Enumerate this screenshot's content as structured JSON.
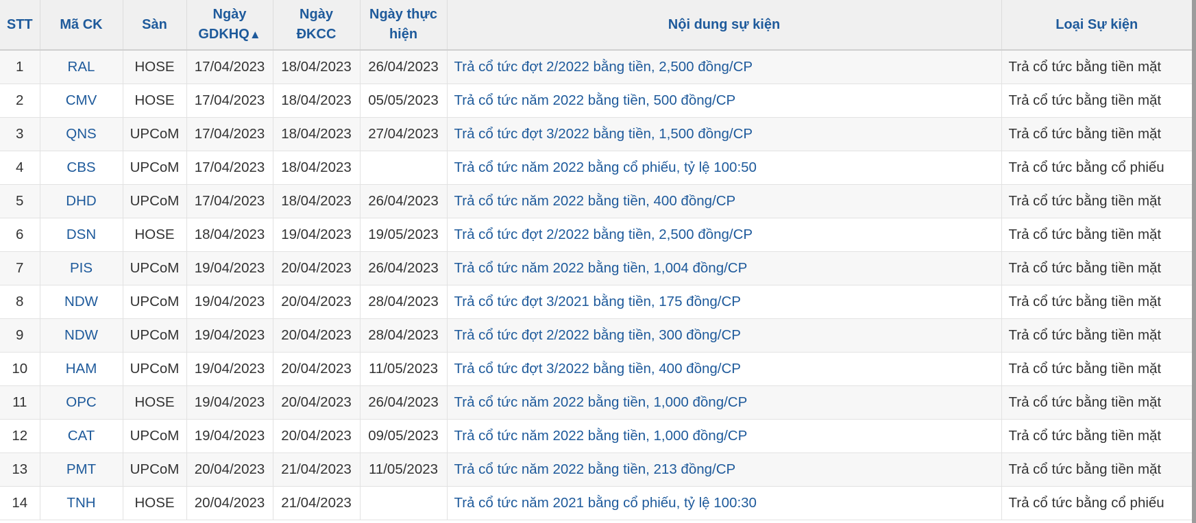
{
  "table": {
    "headers": {
      "stt": "STT",
      "ma_ck": "Mã CK",
      "san": "Sàn",
      "gdkhq_line1": "Ngày",
      "gdkhq_line2": "GDKHQ",
      "gdkhq_sort": "▲",
      "dkcc_line1": "Ngày",
      "dkcc_line2": "ĐKCC",
      "thuc_hien_line1": "Ngày thực",
      "thuc_hien_line2": "hiện",
      "noi_dung": "Nội dung sự kiện",
      "loai": "Loại Sự kiện"
    },
    "rows": [
      {
        "stt": "1",
        "ma": "RAL",
        "san": "HOSE",
        "gdkhq": "17/04/2023",
        "dkcc": "18/04/2023",
        "thuc_hien": "26/04/2023",
        "noi_dung": "Trả cổ tức đợt 2/2022 bằng tiền, 2,500 đồng/CP",
        "loai": "Trả cổ tức bằng tiền mặt"
      },
      {
        "stt": "2",
        "ma": "CMV",
        "san": "HOSE",
        "gdkhq": "17/04/2023",
        "dkcc": "18/04/2023",
        "thuc_hien": "05/05/2023",
        "noi_dung": "Trả cổ tức năm 2022 bằng tiền, 500 đồng/CP",
        "loai": "Trả cổ tức bằng tiền mặt"
      },
      {
        "stt": "3",
        "ma": "QNS",
        "san": "UPCoM",
        "gdkhq": "17/04/2023",
        "dkcc": "18/04/2023",
        "thuc_hien": "27/04/2023",
        "noi_dung": "Trả cổ tức đợt 3/2022 bằng tiền, 1,500 đồng/CP",
        "loai": "Trả cổ tức bằng tiền mặt"
      },
      {
        "stt": "4",
        "ma": "CBS",
        "san": "UPCoM",
        "gdkhq": "17/04/2023",
        "dkcc": "18/04/2023",
        "thuc_hien": "",
        "noi_dung": "Trả cổ tức năm 2022 bằng cổ phiếu, tỷ lệ 100:50",
        "loai": "Trả cổ tức bằng cổ phiếu"
      },
      {
        "stt": "5",
        "ma": "DHD",
        "san": "UPCoM",
        "gdkhq": "17/04/2023",
        "dkcc": "18/04/2023",
        "thuc_hien": "26/04/2023",
        "noi_dung": "Trả cổ tức năm 2022 bằng tiền, 400 đồng/CP",
        "loai": "Trả cổ tức bằng tiền mặt"
      },
      {
        "stt": "6",
        "ma": "DSN",
        "san": "HOSE",
        "gdkhq": "18/04/2023",
        "dkcc": "19/04/2023",
        "thuc_hien": "19/05/2023",
        "noi_dung": "Trả cổ tức đợt 2/2022 bằng tiền, 2,500 đồng/CP",
        "loai": "Trả cổ tức bằng tiền mặt"
      },
      {
        "stt": "7",
        "ma": "PIS",
        "san": "UPCoM",
        "gdkhq": "19/04/2023",
        "dkcc": "20/04/2023",
        "thuc_hien": "26/04/2023",
        "noi_dung": "Trả cổ tức năm 2022 bằng tiền, 1,004 đồng/CP",
        "loai": "Trả cổ tức bằng tiền mặt"
      },
      {
        "stt": "8",
        "ma": "NDW",
        "san": "UPCoM",
        "gdkhq": "19/04/2023",
        "dkcc": "20/04/2023",
        "thuc_hien": "28/04/2023",
        "noi_dung": "Trả cổ tức đợt 3/2021 bằng tiền, 175 đồng/CP",
        "loai": "Trả cổ tức bằng tiền mặt"
      },
      {
        "stt": "9",
        "ma": "NDW",
        "san": "UPCoM",
        "gdkhq": "19/04/2023",
        "dkcc": "20/04/2023",
        "thuc_hien": "28/04/2023",
        "noi_dung": "Trả cổ tức đợt 2/2022 bằng tiền, 300 đồng/CP",
        "loai": "Trả cổ tức bằng tiền mặt"
      },
      {
        "stt": "10",
        "ma": "HAM",
        "san": "UPCoM",
        "gdkhq": "19/04/2023",
        "dkcc": "20/04/2023",
        "thuc_hien": "11/05/2023",
        "noi_dung": "Trả cổ tức đợt 3/2022 bằng tiền, 400 đồng/CP",
        "loai": "Trả cổ tức bằng tiền mặt"
      },
      {
        "stt": "11",
        "ma": "OPC",
        "san": "HOSE",
        "gdkhq": "19/04/2023",
        "dkcc": "20/04/2023",
        "thuc_hien": "26/04/2023",
        "noi_dung": "Trả cổ tức năm 2022 bằng tiền, 1,000 đồng/CP",
        "loai": "Trả cổ tức bằng tiền mặt"
      },
      {
        "stt": "12",
        "ma": "CAT",
        "san": "UPCoM",
        "gdkhq": "19/04/2023",
        "dkcc": "20/04/2023",
        "thuc_hien": "09/05/2023",
        "noi_dung": "Trả cổ tức năm 2022 bằng tiền, 1,000 đồng/CP",
        "loai": "Trả cổ tức bằng tiền mặt"
      },
      {
        "stt": "13",
        "ma": "PMT",
        "san": "UPCoM",
        "gdkhq": "20/04/2023",
        "dkcc": "21/04/2023",
        "thuc_hien": "11/05/2023",
        "noi_dung": "Trả cổ tức năm 2022 bằng tiền, 213 đồng/CP",
        "loai": "Trả cổ tức bằng tiền mặt"
      },
      {
        "stt": "14",
        "ma": "TNH",
        "san": "HOSE",
        "gdkhq": "20/04/2023",
        "dkcc": "21/04/2023",
        "thuc_hien": "",
        "noi_dung": "Trả cổ tức năm 2021 bằng cổ phiếu, tỷ lệ 100:30",
        "loai": "Trả cổ tức bằng cổ phiếu"
      }
    ]
  }
}
